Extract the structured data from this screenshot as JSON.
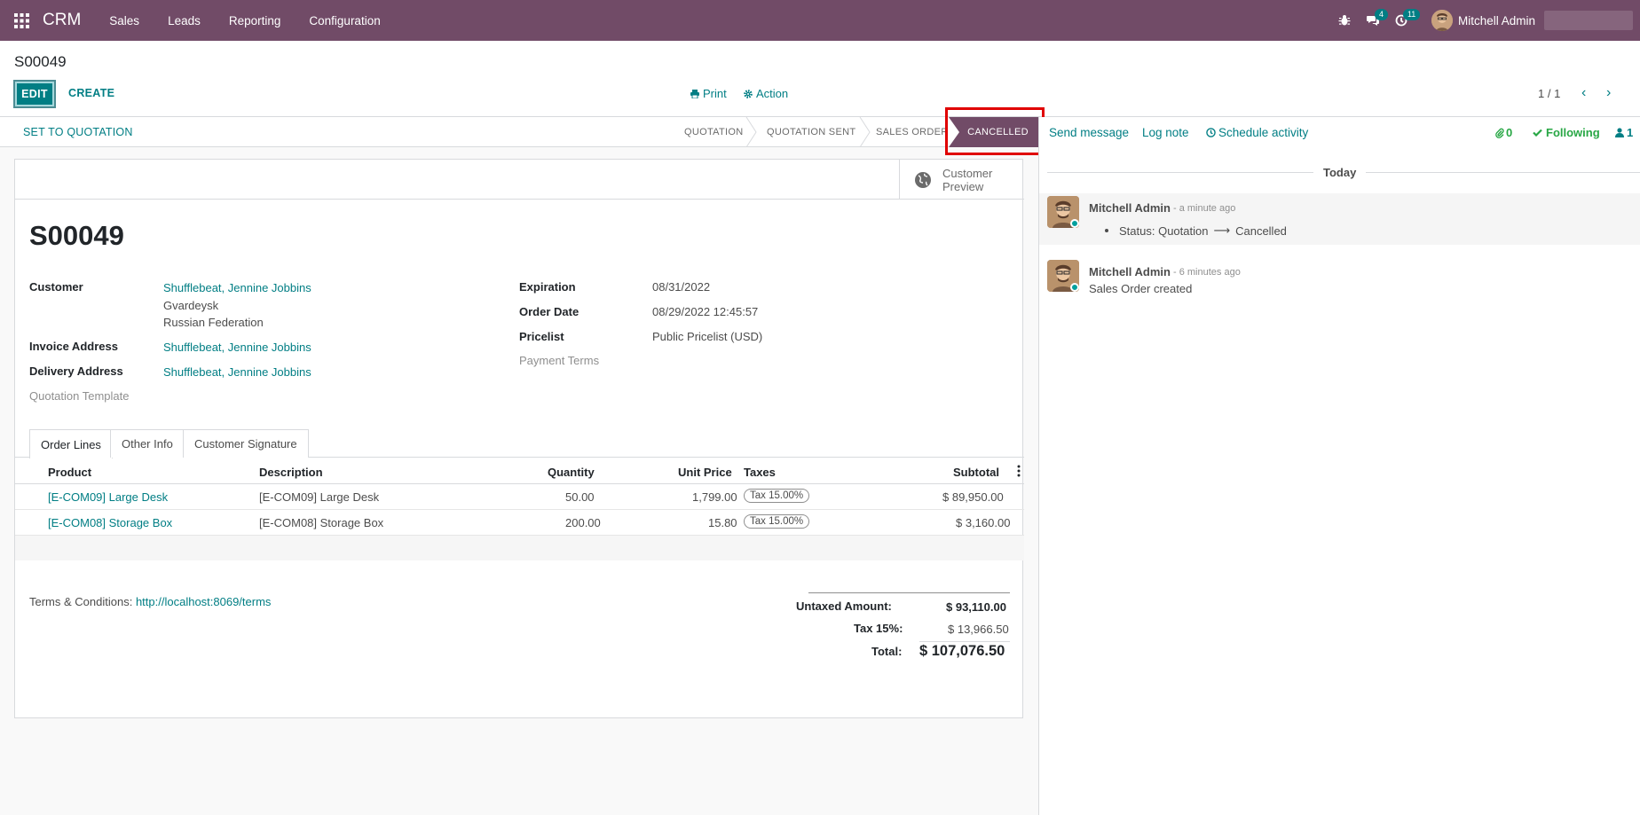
{
  "navbar": {
    "brand": "CRM",
    "menu": [
      "Sales",
      "Leads",
      "Reporting",
      "Configuration"
    ],
    "messages_badge": "4",
    "activities_badge": "11",
    "user_name": "Mitchell Admin"
  },
  "control": {
    "breadcrumb": "S00049",
    "edit_label": "EDIT",
    "create_label": "CREATE",
    "print_label": "Print",
    "action_label": "Action",
    "pager": "1 / 1"
  },
  "statusbar": {
    "set_to_quotation": "SET TO QUOTATION",
    "stages": [
      "QUOTATION",
      "QUOTATION SENT",
      "SALES ORDER"
    ],
    "active_stage": "CANCELLED"
  },
  "sheet": {
    "customer_preview": [
      "Customer",
      "Preview"
    ],
    "title": "S00049",
    "left_fields": {
      "customer_label": "Customer",
      "customer_name": "Shufflebeat, Jennine Jobbins",
      "customer_city": "Gvardeysk",
      "customer_country": "Russian Federation",
      "invoice_label": "Invoice Address",
      "invoice_value": "Shufflebeat, Jennine Jobbins",
      "delivery_label": "Delivery Address",
      "delivery_value": "Shufflebeat, Jennine Jobbins",
      "template_label": "Quotation Template"
    },
    "right_fields": {
      "expiration_label": "Expiration",
      "expiration_value": "08/31/2022",
      "order_date_label": "Order Date",
      "order_date_value": "08/29/2022 12:45:57",
      "pricelist_label": "Pricelist",
      "pricelist_value": "Public Pricelist (USD)",
      "payment_terms_label": "Payment Terms"
    },
    "tabs": [
      "Order Lines",
      "Other Info",
      "Customer Signature"
    ],
    "columns": [
      "Product",
      "Description",
      "Quantity",
      "Unit Price",
      "Taxes",
      "Subtotal"
    ],
    "rows": [
      {
        "product": "[E-COM09] Large Desk",
        "description": "[E-COM09] Large Desk",
        "quantity": "50.00",
        "unit_price": "1,799.00",
        "taxes": "Tax 15.00%",
        "subtotal": "$ 89,950.00"
      },
      {
        "product": "[E-COM08] Storage Box",
        "description": "[E-COM08] Storage Box",
        "quantity": "200.00",
        "unit_price": "15.80",
        "taxes": "Tax 15.00%",
        "subtotal": "$ 3,160.00"
      }
    ],
    "terms_label": "Terms & Conditions:",
    "terms_link": "http://localhost:8069/terms",
    "totals": {
      "untaxed_label": "Untaxed Amount:",
      "untaxed_value": "$ 93,110.00",
      "tax_label": "Tax 15%:",
      "tax_value": "$ 13,966.50",
      "total_label": "Total:",
      "total_value": "$ 107,076.50"
    }
  },
  "chatter": {
    "send_message": "Send message",
    "log_note": "Log note",
    "schedule_activity": "Schedule activity",
    "attachments_count": "0",
    "following": "Following",
    "followers_count": "1",
    "today": "Today",
    "messages": [
      {
        "author": "Mitchell Admin",
        "date": "- a minute ago",
        "status_text": "Status: Quotation",
        "arrow": "⟶",
        "status_new": "Cancelled"
      },
      {
        "author": "Mitchell Admin",
        "date": "- 6 minutes ago",
        "body": "Sales Order created"
      }
    ]
  },
  "colors": {
    "brand": "#714b67",
    "accent": "#017e84",
    "highlight": "#e00000"
  }
}
